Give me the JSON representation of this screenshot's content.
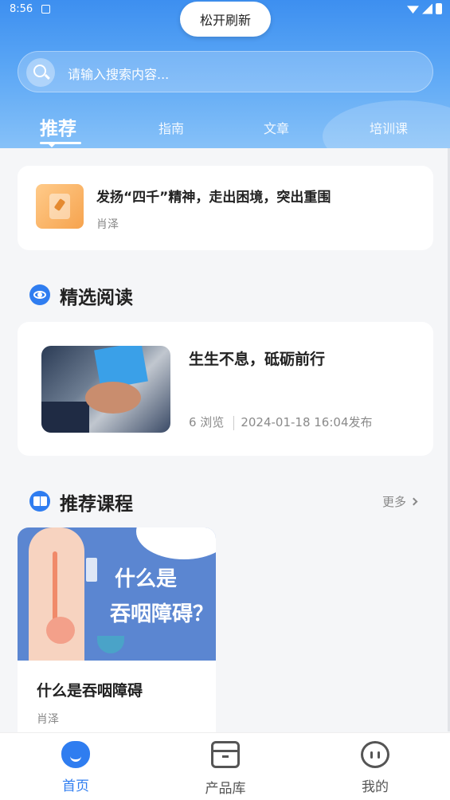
{
  "status_bar": {
    "time": "8:56"
  },
  "refresh_hint": "松开刷新",
  "search": {
    "placeholder": "请输入搜索内容..."
  },
  "tabs": [
    {
      "label": "推荐",
      "active": true
    },
    {
      "label": "指南",
      "active": false
    },
    {
      "label": "文章",
      "active": false
    },
    {
      "label": "培训课",
      "active": false
    }
  ],
  "top_article": {
    "title": "发扬“四千”精神，走出困境，突出重围",
    "author": "肖泽"
  },
  "featured_section": {
    "title": "精选阅读",
    "item": {
      "title": "生生不息，砥砺前行",
      "views": "6 浏览",
      "published": "2024-01-18 16:04发布"
    }
  },
  "courses_section": {
    "title": "推荐课程",
    "more_label": "更多",
    "items": [
      {
        "banner_line1": "什么是",
        "banner_line2": "吞咽障碍？",
        "title": "什么是吞咽障碍",
        "author": "肖泽"
      }
    ]
  },
  "bottom_nav": [
    {
      "label": "首页",
      "icon": "home-icon",
      "active": true
    },
    {
      "label": "产品库",
      "icon": "box-icon",
      "active": false
    },
    {
      "label": "我的",
      "icon": "face-icon",
      "active": false
    }
  ],
  "colors": {
    "brand": "#2f7df0",
    "header_top": "#3d8ff0",
    "header_bottom": "#86c1f8"
  }
}
